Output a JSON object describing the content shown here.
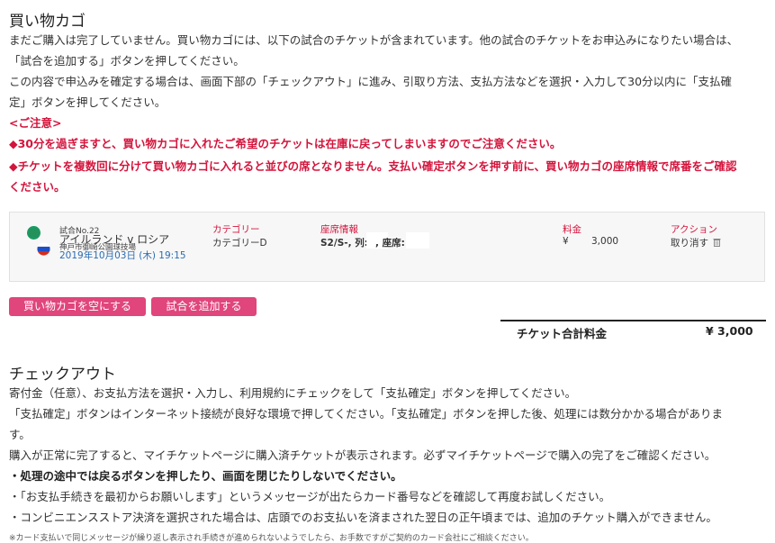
{
  "cart": {
    "title": "買い物カゴ",
    "intro_line1": "まだご購入は完了していません。買い物カゴには、以下の試合のチケットが含まれています。他の試合のチケットをお申込みになりたい場合は、",
    "intro_line2": "「試合を追加する」ボタンを押してください。",
    "intro_line3": "この内容で申込みを確定する場合は、画面下部の「チェックアウト」に進み、引取り方法、支払方法などを選択・入力して30分以内に「支払確",
    "intro_line4": "定」ボタンを押してください。",
    "notice_heading": "<ご注意>",
    "notice1": "◆30分を過ぎますと、買い物カゴに入れたご希望のチケットは在庫に戻ってしまいますのでご注意ください。",
    "notice2_line1": "◆チケットを複数回に分けて買い物カゴに入れると並びの席となりません。支払い確定ボタンを押す前に、買い物カゴの座席情報で席番をご確認",
    "notice2_line2": "ください。"
  },
  "ticket": {
    "match_no": "試合No.22",
    "teams": "アイルランド v ロシア",
    "venue": "神戸市御崎公園球技場",
    "datetime": "2019年10月03日 (木) 19:15",
    "category_label": "カテゴリー",
    "category_value": "カテゴリーD",
    "seat_label": "座席情報",
    "seat_value": "S2/S-, 列:",
    "seat_value2": ", 座席:",
    "price_label": "料金",
    "price_currency": "¥",
    "price_value": "3,000",
    "action_label": "アクション",
    "remove_label": "取り消す",
    "remove_icon": "trash-icon"
  },
  "buttons": {
    "empty_cart": "買い物カゴを空にする",
    "add_match": "試合を追加する"
  },
  "total": {
    "label": "チケット合計料金",
    "value": "¥ 3,000"
  },
  "checkout": {
    "title": "チェックアウト",
    "line1": "寄付金（任意）、お支払方法を選択・入力し、利用規約にチェックをして「支払確定」ボタンを押してください。",
    "line2": "「支払確定」ボタンはインターネット接続が良好な環境で押してください。「支払確定」ボタンを押した後、処理には数分かかる場合がありま",
    "line3": "す。",
    "line4": "購入が正常に完了すると、マイチケットページに購入済チケットが表示されます。必ずマイチケットページで購入の完了をご確認ください。",
    "line5": "・処理の途中では戻るボタンを押したり、画面を閉じたりしないでください。",
    "line6": "・「お支払手続きを最初からお願いします」というメッセージが出たらカード番号などを確認して再度お試しください。",
    "line7": "・コンビニエンスストア決済を選択された場合は、店頭でのお支払いを済まされた翌日の正午頃までは、追加のチケット購入ができません。",
    "footnote": "※カード支払いで同じメッセージが繰り返し表示され手続きが進められないようでしたら、お手数ですがご契約のカード会社にご相談ください。"
  },
  "colors": {
    "accent": "#e0457b",
    "alert": "#d4143c"
  }
}
